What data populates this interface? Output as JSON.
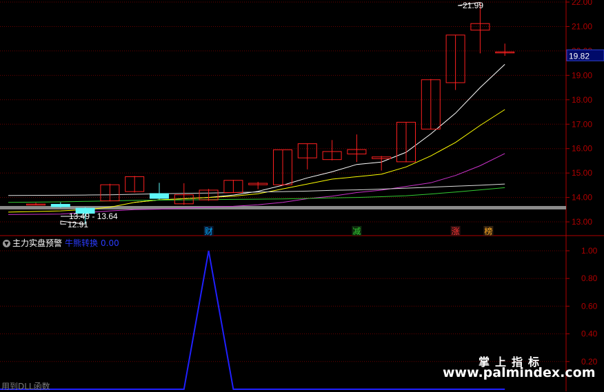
{
  "chart_data": [
    {
      "type": "candlestick",
      "y_axis_ticks": [
        "22.00",
        "21.00",
        "20.00",
        "19.00",
        "18.00",
        "17.00",
        "16.00",
        "15.00",
        "14.00",
        "13.00"
      ],
      "ylim": [
        12.6,
        22.1
      ],
      "current_price_label": "19.82",
      "candles": [
        {
          "o": 13.72,
          "h": 13.78,
          "l": 13.7,
          "c": 13.73
        },
        {
          "o": 13.72,
          "h": 13.8,
          "l": 13.58,
          "c": 13.62
        },
        {
          "o": 13.56,
          "h": 13.6,
          "l": 12.91,
          "c": 13.35
        },
        {
          "o": 13.86,
          "h": 14.56,
          "l": 13.84,
          "c": 14.52
        },
        {
          "o": 14.24,
          "h": 14.88,
          "l": 14.2,
          "c": 14.85
        },
        {
          "o": 14.16,
          "h": 14.6,
          "l": 13.92,
          "c": 13.96
        },
        {
          "o": 13.74,
          "h": 14.58,
          "l": 13.7,
          "c": 14.11
        },
        {
          "o": 13.9,
          "h": 14.35,
          "l": 13.86,
          "c": 14.3
        },
        {
          "o": 14.2,
          "h": 14.72,
          "l": 14.18,
          "c": 14.7
        },
        {
          "o": 14.52,
          "h": 14.64,
          "l": 14.34,
          "c": 14.58
        },
        {
          "o": 14.52,
          "h": 15.95,
          "l": 14.48,
          "c": 15.95
        },
        {
          "o": 15.62,
          "h": 16.2,
          "l": 15.15,
          "c": 16.2
        },
        {
          "o": 15.55,
          "h": 16.35,
          "l": 15.52,
          "c": 15.88
        },
        {
          "o": 15.78,
          "h": 16.58,
          "l": 15.45,
          "c": 15.96
        },
        {
          "o": 15.59,
          "h": 15.7,
          "l": 15.1,
          "c": 15.66
        },
        {
          "o": 15.46,
          "h": 17.08,
          "l": 15.44,
          "c": 17.08
        },
        {
          "o": 16.8,
          "h": 18.85,
          "l": 16.78,
          "c": 18.82
        },
        {
          "o": 18.7,
          "h": 20.65,
          "l": 18.4,
          "c": 20.65
        },
        {
          "o": 20.85,
          "h": 21.99,
          "l": 19.9,
          "c": 21.12
        },
        {
          "o": 19.92,
          "h": 20.3,
          "l": 19.8,
          "c": 19.96
        }
      ],
      "ma_lines": [
        {
          "color": "#ffffff",
          "values": [
            null,
            null,
            null,
            null,
            13.8,
            13.9,
            13.95,
            14.0,
            14.1,
            14.25,
            14.5,
            14.8,
            15.05,
            15.35,
            15.45,
            15.85,
            16.6,
            17.45,
            18.5,
            19.45
          ]
        },
        {
          "color": "#ffff00",
          "values": [
            13.4,
            13.45,
            13.5,
            13.6,
            13.8,
            13.9,
            13.95,
            14.0,
            14.05,
            14.15,
            14.35,
            14.55,
            14.75,
            14.85,
            14.95,
            15.25,
            15.7,
            16.25,
            16.95,
            17.6
          ]
        },
        {
          "color": "#cc33cc",
          "values": [
            13.3,
            13.32,
            13.38,
            13.45,
            13.5,
            13.52,
            13.56,
            13.6,
            13.64,
            13.7,
            13.8,
            13.95,
            14.05,
            14.2,
            14.3,
            14.45,
            14.6,
            14.9,
            15.3,
            15.8
          ]
        },
        {
          "color": "#dddddd",
          "values": [
            14.08,
            14.09,
            14.1,
            14.11,
            14.13,
            14.15,
            14.17,
            14.18,
            14.2,
            14.22,
            14.24,
            14.26,
            14.29,
            14.31,
            14.34,
            14.38,
            14.42,
            14.46,
            14.5,
            14.55
          ]
        },
        {
          "color": "#33cc33",
          "values": [
            13.8,
            13.82,
            13.84,
            13.86,
            13.88,
            13.89,
            13.9,
            13.91,
            13.92,
            13.93,
            13.94,
            13.96,
            13.98,
            14.0,
            14.03,
            14.07,
            14.14,
            14.22,
            14.31,
            14.4
          ]
        }
      ],
      "annotations": {
        "low_label": "12.91",
        "range_label": "13.49 - 13.64",
        "high_label": "21.99"
      },
      "event_markers": [
        {
          "index": 7,
          "label": "财",
          "color": "#00aaff",
          "bg": "#0a1830"
        },
        {
          "index": 13,
          "label": "减",
          "color": "#33cc33",
          "bg": "#0d2a0d"
        },
        {
          "index": 17,
          "label": "涨",
          "color": "#ff3333",
          "bg": "#301010"
        },
        {
          "index": 18,
          "label": "榜",
          "color": "#ffaa22",
          "bg": "#302010"
        }
      ],
      "colors": {
        "up": "#ff2020",
        "down": "#5ef8f8",
        "axis": "#b00000",
        "grid": "#6e0000"
      }
    },
    {
      "type": "line",
      "title": "主力实盘预警",
      "signal_label": "牛熊转换",
      "signal_value": "0.00",
      "y_axis_ticks": [
        "1.00",
        "0.80",
        "0.60",
        "0.40",
        "0.20"
      ],
      "ylim": [
        -0.01,
        1.03
      ],
      "series": [
        {
          "color": "#2020ff",
          "values": [
            0,
            0,
            0,
            0,
            0,
            0,
            0,
            1,
            0,
            0,
            0,
            0,
            0,
            0,
            0,
            0,
            0,
            0,
            0,
            0
          ]
        }
      ]
    }
  ],
  "watermark": {
    "cn": "掌上指标",
    "url": "www.palmindex.com"
  },
  "bottom_note": "用到DLL函数"
}
